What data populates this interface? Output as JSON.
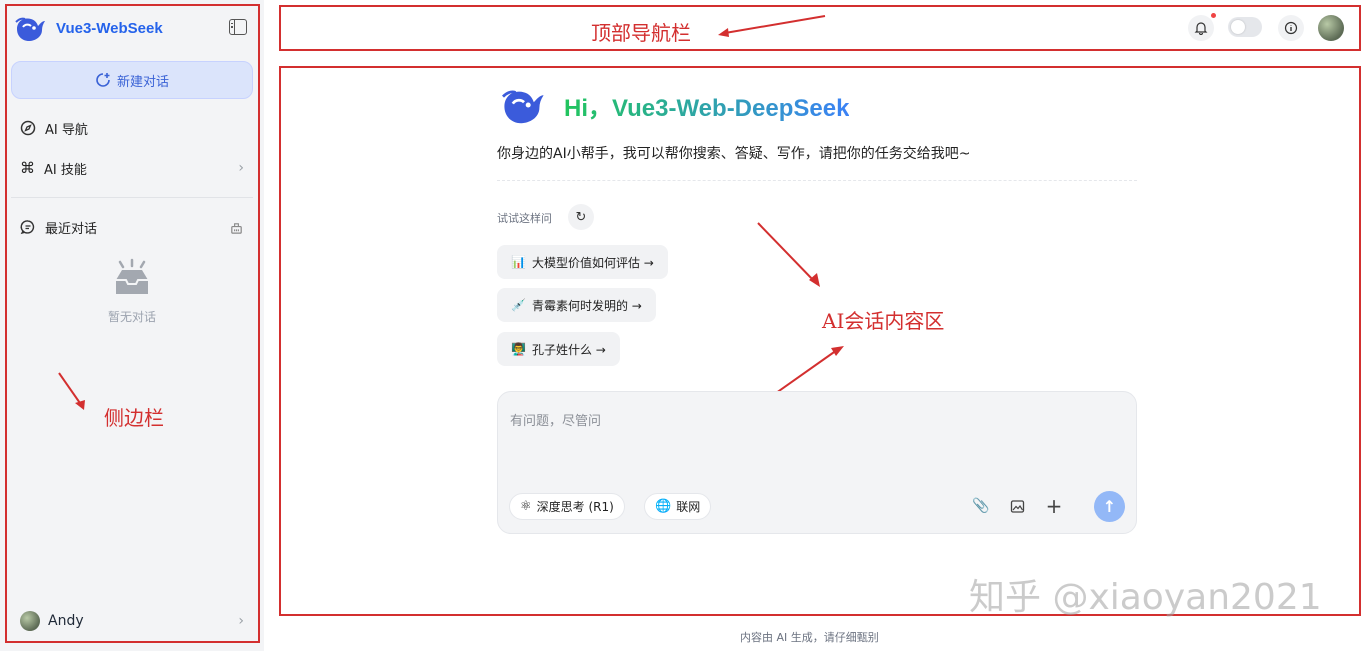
{
  "sidebar": {
    "brand": "Vue3-WebSeek",
    "new_chat": "新建对话",
    "nav": [
      {
        "label": "AI 导航",
        "icon": "compass-icon"
      },
      {
        "label": "AI 技能",
        "icon": "command-icon"
      }
    ],
    "recent_title": "最近对话",
    "empty_text": "暂无对话",
    "annotation": "侧边栏",
    "user": {
      "name": "Andy"
    }
  },
  "topnav": {
    "annotation": "顶部导航栏"
  },
  "main": {
    "hero_title": "Hi，Vue3-Web-DeepSeek",
    "subtitle": "你身边的AI小帮手，我可以帮你搜索、答疑、写作，请把你的任务交给我吧~",
    "try_label": "试试这样问",
    "suggestions": [
      {
        "emoji": "📊",
        "text": "大模型价值如何评估 →"
      },
      {
        "emoji": "💉",
        "text": "青霉素何时发明的 →"
      },
      {
        "emoji": "👨‍🏫",
        "text": "孔子姓什么 →"
      }
    ],
    "input_placeholder": "有问题，尽管问",
    "deep_think": "深度思考 (R1)",
    "web_search": "联网",
    "annotation": "AI会话内容区",
    "watermark": "知乎 @xiaoyan2021"
  },
  "footer": "内容由 AI 生成，请仔细甄别",
  "colors": {
    "annotation": "#d32f2f",
    "accent": "#2563eb",
    "send": "#93b8f7"
  }
}
